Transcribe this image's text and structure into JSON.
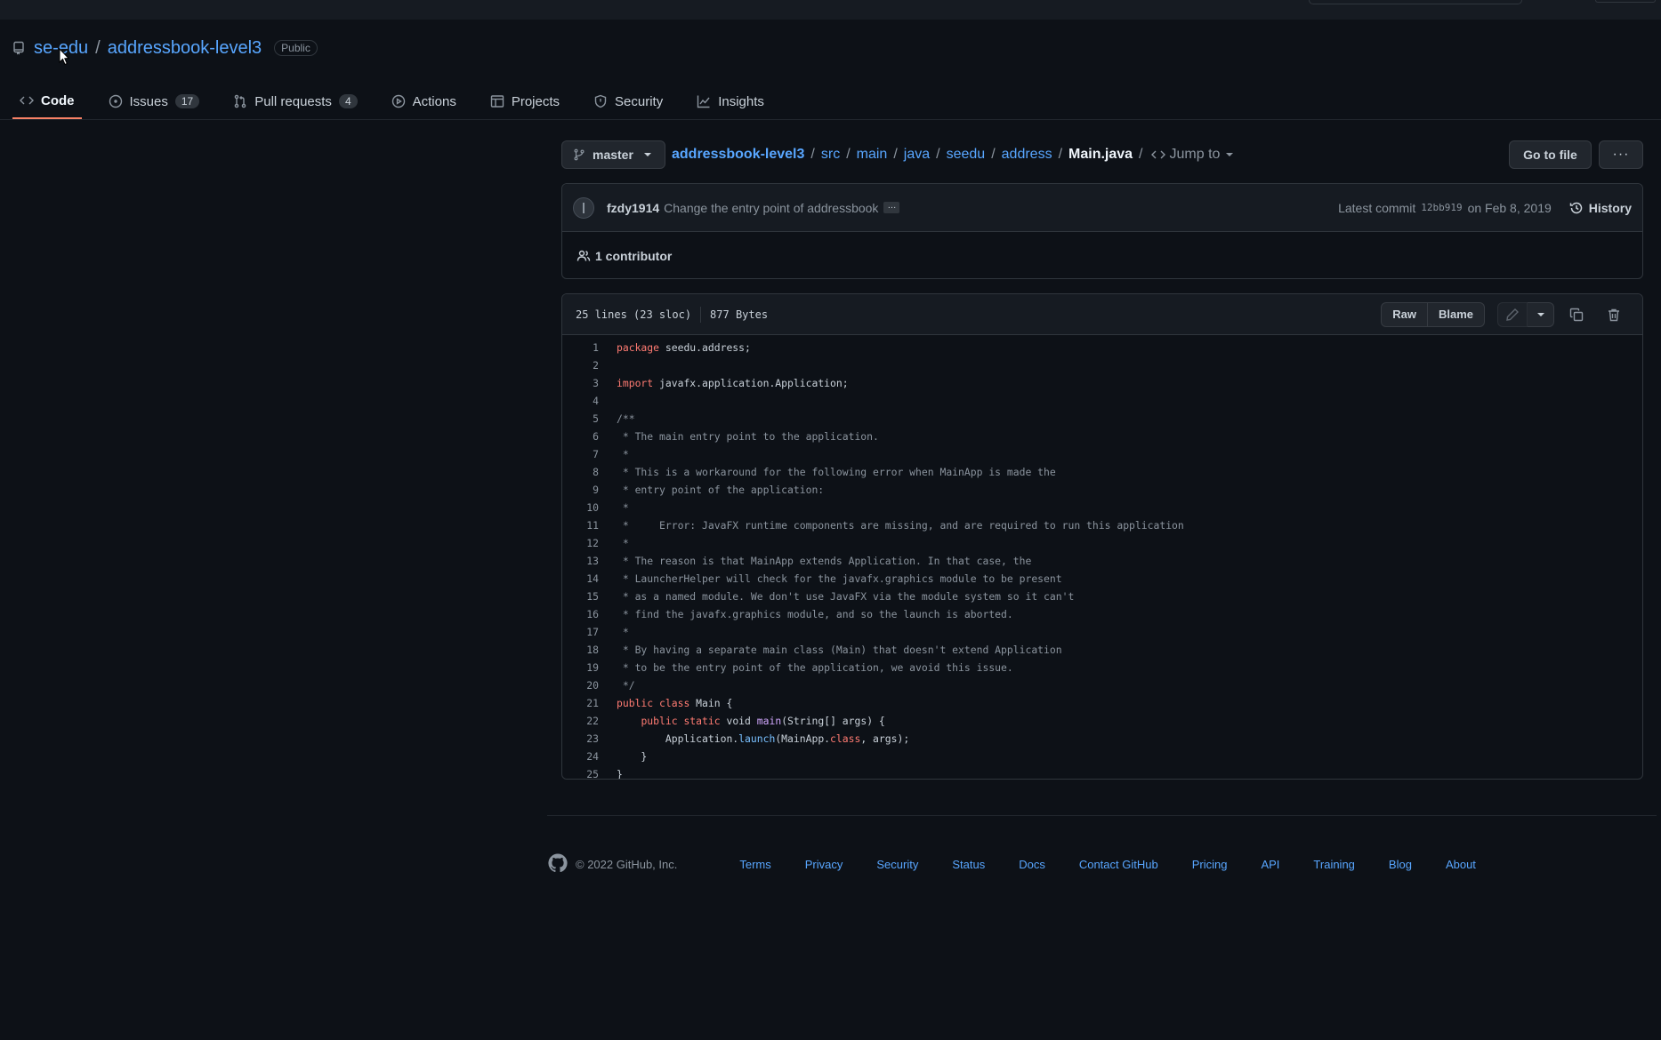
{
  "repo": {
    "owner": "se-edu",
    "separator": "/",
    "name": "addressbook-level3",
    "visibility": "Public"
  },
  "nav": {
    "tabs": [
      {
        "label": "Code",
        "icon": "code-icon",
        "active": true
      },
      {
        "label": "Issues",
        "icon": "issue-icon",
        "count": "17"
      },
      {
        "label": "Pull requests",
        "icon": "pull-request-icon",
        "count": "4"
      },
      {
        "label": "Actions",
        "icon": "play-icon"
      },
      {
        "label": "Projects",
        "icon": "table-icon"
      },
      {
        "label": "Security",
        "icon": "shield-icon"
      },
      {
        "label": "Insights",
        "icon": "graph-icon"
      }
    ]
  },
  "file_header": {
    "branch": "master",
    "breadcrumb": [
      "addressbook-level3",
      "src",
      "main",
      "java",
      "seedu",
      "address"
    ],
    "current_file": "Main.java",
    "jump_to": "Jump to",
    "goto_label": "Go to file",
    "more_label": "···"
  },
  "commit": {
    "author": "fzdy1914",
    "message": "Change the entry point of addressbook",
    "ellipsis": "…",
    "latest_label": "Latest commit",
    "sha": "12bb919",
    "date": "on Feb 8, 2019",
    "history_label": "History",
    "contributors": "1 contributor"
  },
  "file": {
    "lines_info": "25 lines (23 sloc)",
    "size": "877 Bytes",
    "raw_label": "Raw",
    "blame_label": "Blame"
  },
  "code_lines": [
    "package seedu.address;",
    "",
    "import javafx.application.Application;",
    "",
    "/**",
    " * The main entry point to the application.",
    " *",
    " * This is a workaround for the following error when MainApp is made the",
    " * entry point of the application:",
    " *",
    " *     Error: JavaFX runtime components are missing, and are required to run this application",
    " *",
    " * The reason is that MainApp extends Application. In that case, the",
    " * LauncherHelper will check for the javafx.graphics module to be present",
    " * as a named module. We don't use JavaFX via the module system so it can't",
    " * find the javafx.graphics module, and so the launch is aborted.",
    " *",
    " * By having a separate main class (Main) that doesn't extend Application",
    " * to be the entry point of the application, we avoid this issue.",
    " */",
    "public class Main {",
    "    public static void main(String[] args) {",
    "        Application.launch(MainApp.class, args);",
    "    }",
    "}"
  ],
  "footer": {
    "copyright": "© 2022 GitHub, Inc.",
    "links": [
      "Terms",
      "Privacy",
      "Security",
      "Status",
      "Docs",
      "Contact GitHub",
      "Pricing",
      "API",
      "Training",
      "Blog",
      "About"
    ]
  },
  "colors": {
    "background": "#0d1117",
    "link": "#58a6ff",
    "active_tab_underline": "#f78166",
    "keyword": "#ff7b72",
    "comment": "#8b949e"
  }
}
